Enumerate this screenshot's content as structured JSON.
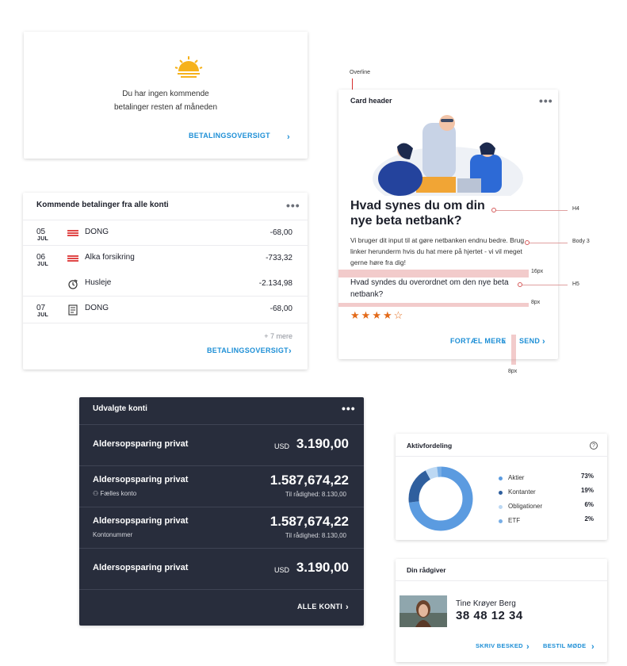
{
  "no_payments": {
    "message": "Du har ingen kommende betalinger resten af måneden",
    "link": "BETALINGSOVERSIGT",
    "icon": "sunset-icon"
  },
  "upcoming": {
    "title": "Kommende betalinger fra alle konti",
    "rows": [
      {
        "day": "05",
        "month": "JUL",
        "icon": "dong-logo-icon",
        "name": "DONG",
        "amount": "-68,00"
      },
      {
        "day": "06",
        "month": "JUL",
        "icon": "alka-logo-icon",
        "name": "Alka forsikring",
        "amount": "-733,32"
      },
      {
        "day": "",
        "month": "",
        "icon": "recurring-icon",
        "name": "Husleje",
        "amount": "-2.134,98"
      },
      {
        "day": "07",
        "month": "JUL",
        "icon": "bill-icon",
        "name": "DONG",
        "amount": "-68,00"
      }
    ],
    "more": "+ 7 mere",
    "link": "BETALINGSOVERSIGT"
  },
  "survey": {
    "overline_annotation": "Overline",
    "header": "Card header",
    "title": "Hvad synes du om din nye beta netbank?",
    "body": "Vi bruger dit input til at gøre netbanken endnu bedre. Brug linker herunderm hvis du hat mere på hjertet - vi vil meget gerne høre fra dig!",
    "question": "Hvad syndes du overordnet om den nye beta netbank?",
    "rating": 4,
    "rating_max": 5,
    "link_more": "FORTÆL MERE",
    "link_send": "SEND",
    "annotations": {
      "h4": "H4",
      "body3": "Body 3",
      "h5": "H5",
      "space16": "16px",
      "space8a": "8px",
      "space8b": "8px"
    }
  },
  "accounts": {
    "title": "Udvalgte konti",
    "rows": [
      {
        "name": "Aldersopsparing privat",
        "currency": "USD",
        "value": "3.190,00",
        "sub": "",
        "available": ""
      },
      {
        "name": "Aldersopsparing privat",
        "currency": "",
        "value": "1.587,674,22",
        "sub": "Fælles konto",
        "available": "Til rådighed: 8.130,00"
      },
      {
        "name": "Aldersopsparing privat",
        "currency": "",
        "value": "1.587,674,22",
        "sub": "Kontonummer",
        "available": "Til rådighed: 8.130,00"
      },
      {
        "name": "Aldersopsparing privat",
        "currency": "USD",
        "value": "3.190,00",
        "sub": "",
        "available": ""
      }
    ],
    "link": "ALLE KONTI"
  },
  "allocation": {
    "title": "Aktivfordeling",
    "help": "?"
  },
  "chart_data": {
    "type": "pie",
    "title": "Aktivfordeling",
    "categories": [
      "Aktier",
      "Kontanter",
      "Obligationer",
      "ETF"
    ],
    "values": [
      73,
      19,
      6,
      2
    ],
    "labels": [
      "73%",
      "19%",
      "6%",
      "2%"
    ],
    "colors": [
      "#5b9be0",
      "#2f5f9e",
      "#bcd8f3",
      "#78aee6"
    ]
  },
  "advisor": {
    "title": "Din rådgiver",
    "name": "Tine Krøyer Berg",
    "phone": "38 48 12 34",
    "link_message": "SKRIV BESKED",
    "link_meeting": "BESTIL MØDE"
  }
}
